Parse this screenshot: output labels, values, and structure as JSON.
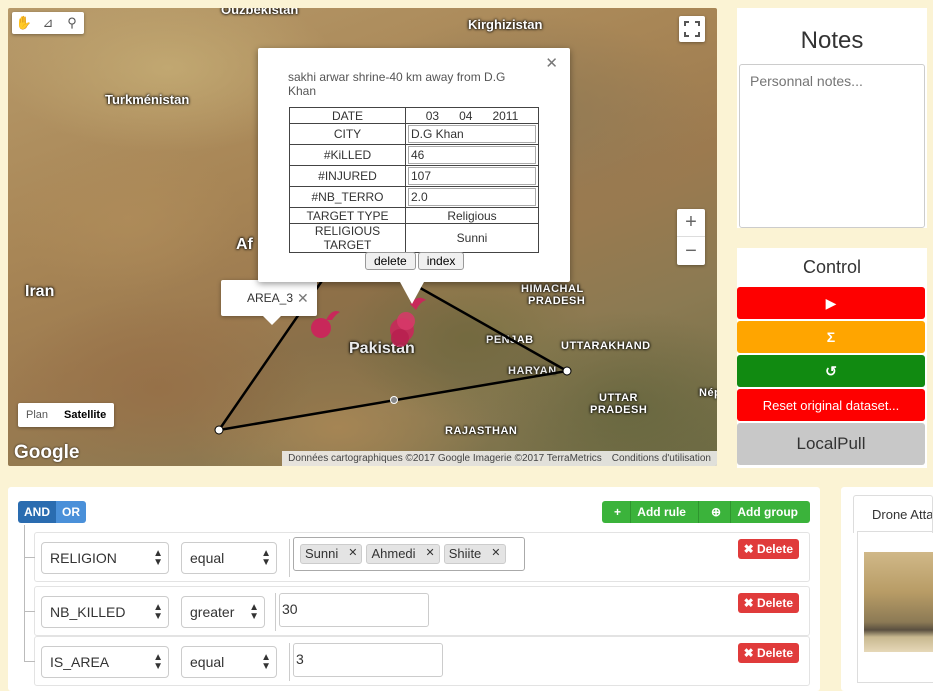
{
  "map": {
    "labels": {
      "uzbekistan": "Ouzbékistan",
      "kirghizistan": "Kirghizistan",
      "turkmenistan": "Turkménistan",
      "afghanistan": "Af",
      "iran": "Iran",
      "pakistan": "Pakistan",
      "himachal": "HIMACHAL",
      "pradesh": "PRADESH",
      "penjab": "PENJAB",
      "uttarakhand": "UTTARAKHAND",
      "haryana": "HARYAN",
      "uttar": "UTTAR",
      "uttar_pradesh": "PRADESH",
      "nep": "Nép",
      "rajasthan": "RAJASTHAN"
    },
    "map_type": {
      "plan": "Plan",
      "satellite": "Satellite",
      "selected": "Satellite"
    },
    "logo": "Google",
    "attribution": "Données cartographiques ©2017 Google Imagerie ©2017 TerraMetrics",
    "terms": "Conditions d'utilisation",
    "zoom_in": "+",
    "zoom_out": "−",
    "area_tooltip": {
      "label": "AREA_3",
      "close": "✕"
    },
    "info_window": {
      "title": "sakhi arwar shrine-40 km away from D.G Khan",
      "close": "✕",
      "rows": {
        "date_label": "DATE",
        "date_day": "03",
        "date_month": "04",
        "date_year": "2011",
        "city_label": "CITY",
        "city": "D.G Khan",
        "killed_label": "#KiLLED",
        "killed": "46",
        "injured_label": "#INJURED",
        "injured": "107",
        "terro_label": "#NB_TERRO",
        "terro": "2.0",
        "target_type_label": "TARGET TYPE",
        "target_type": "Religious",
        "religious_target_label": "RELIGIOUS TARGET",
        "religious_target": "Sunni"
      },
      "delete_label": "delete",
      "index_label": "index"
    }
  },
  "notes": {
    "title": "Notes",
    "placeholder": "Personnal notes..."
  },
  "control": {
    "title": "Control",
    "play": "▶",
    "sum": "Σ",
    "refresh": "↺",
    "reset": "Reset original dataset...",
    "pull": "LocalPull"
  },
  "query_builder": {
    "and": "AND",
    "or": "OR",
    "add_rule": "Add rule",
    "add_group": "Add group",
    "delete_label": "Delete",
    "rules": [
      {
        "field": "RELIGION",
        "operator": "equal",
        "values": [
          "Sunni",
          "Ahmedi",
          "Shiite"
        ]
      },
      {
        "field": "NB_KILLED",
        "operator": "greater",
        "value": "30"
      },
      {
        "field": "IS_AREA",
        "operator": "equal",
        "value": "3"
      }
    ]
  },
  "drone_panel": {
    "tab": "Drone Atta"
  },
  "colors": {
    "page_bg": "#fbf3d4",
    "red": "#fe0000",
    "orange": "#ffa500",
    "green": "#118a11",
    "gray": "#c8c8c8",
    "and_blue": "#2a6cb0",
    "add_green": "#3bb33b",
    "delete_red": "#e03b3b",
    "marker": "#c8285a"
  }
}
